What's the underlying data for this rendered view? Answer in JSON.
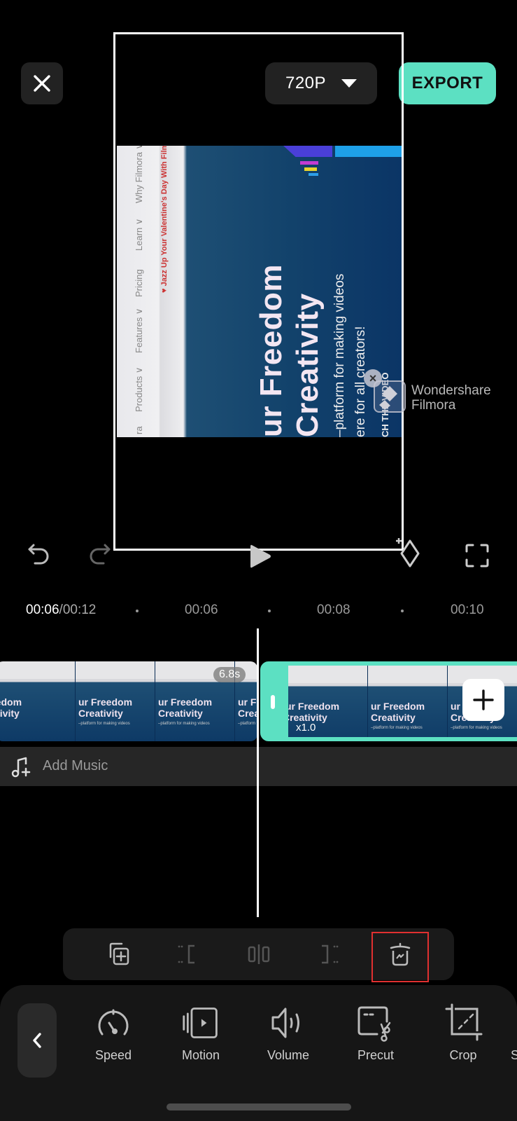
{
  "top_bar": {
    "close_icon": "close-icon",
    "resolution": "720P",
    "resolution_icon": "caret-down-icon",
    "export_label": "EXPORT",
    "accent_color": "#5ce0c2"
  },
  "preview": {
    "nav_items": [
      "ra",
      "Products ∨",
      "Features ∨",
      "Pricing",
      "Learn ∨",
      "Why Filmora ∨"
    ],
    "banner": "♥ Jazz Up Your Valentine's Day With Filmo",
    "headline_1": "ur Freedom",
    "headline_2": "Creativity",
    "subline_1": "–platform for making videos",
    "subline_2": "ere for all creators!",
    "cta": "CH THE VIDEO",
    "watermark_line1": "Wondershare",
    "watermark_line2": "Filmora",
    "watermark_close": "×"
  },
  "playback": {
    "undo_icon": "undo-icon",
    "redo_icon": "redo-icon",
    "play_icon": "play-icon",
    "keyframe_icon": "keyframe-add-icon",
    "fullscreen_icon": "fullscreen-icon",
    "current_time": "00:06",
    "total_time": "/00:12",
    "ruler_ticks": [
      "00:06",
      "00:08",
      "00:10"
    ]
  },
  "timeline": {
    "clips": [
      {
        "duration": "6.8s",
        "thumb_headline_1": "ur Freedom",
        "thumb_headline_2": "Creativity",
        "thumb_sub": "–platform for making videos"
      },
      {
        "speed": "x1.0",
        "selected": true,
        "thumb_headline_1": "ur Freedom",
        "thumb_headline_2": "Creativity",
        "thumb_sub": "–platform for making videos"
      }
    ],
    "add_clip_icon": "plus-icon",
    "music": {
      "icon": "music-add-icon",
      "label": "Add Music"
    }
  },
  "clip_toolbar": {
    "items": [
      {
        "name": "duplicate",
        "icon": "duplicate-icon"
      },
      {
        "name": "trim-start",
        "icon": "trim-start-icon"
      },
      {
        "name": "split",
        "icon": "split-icon"
      },
      {
        "name": "trim-end",
        "icon": "trim-end-icon"
      },
      {
        "name": "delete",
        "icon": "delete-icon",
        "highlighted": true
      }
    ],
    "highlight_color": "#e03030"
  },
  "bottom_panel": {
    "back_icon": "chevron-left-icon",
    "tools": [
      {
        "label": "Speed",
        "icon": "speedometer-icon"
      },
      {
        "label": "Motion",
        "icon": "motion-icon"
      },
      {
        "label": "Volume",
        "icon": "volume-icon"
      },
      {
        "label": "Precut",
        "icon": "precut-icon"
      },
      {
        "label": "Crop",
        "icon": "crop-icon"
      },
      {
        "label": "S",
        "icon": ""
      }
    ]
  }
}
